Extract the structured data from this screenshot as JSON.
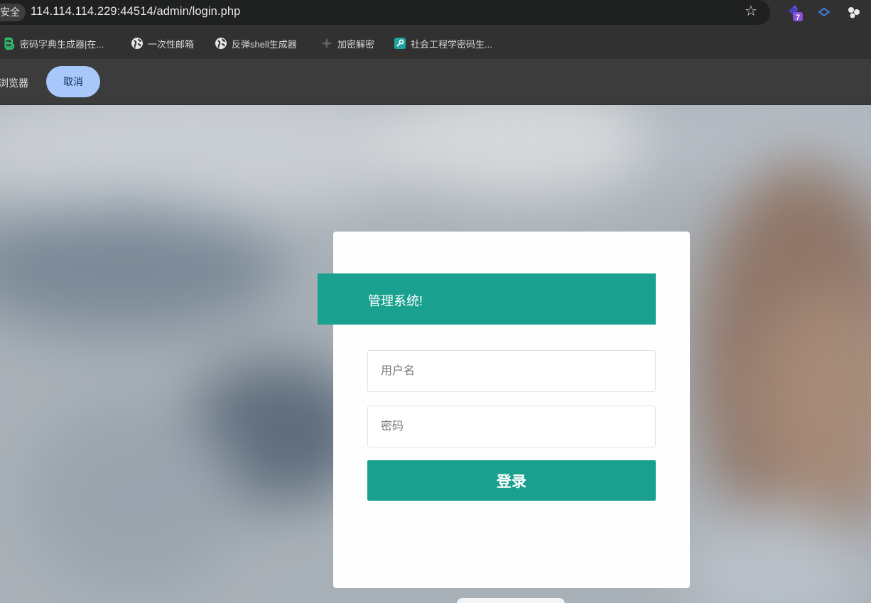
{
  "browser": {
    "security_label": "安全",
    "url": "114.114.114.229:44514/admin/login.php",
    "extension_badge": "7"
  },
  "bookmarks": [
    {
      "label": "密码字典生成器|在...",
      "icon": "b-logo-icon"
    },
    {
      "label": "一次性邮箱",
      "icon": "globe-icon"
    },
    {
      "label": "反弹shell生成器",
      "icon": "globe-icon"
    },
    {
      "label": "加密解密",
      "icon": "star-logo-icon"
    },
    {
      "label": "社会工程学密码生...",
      "icon": "key-square-icon"
    }
  ],
  "infobar": {
    "text": "浏览器",
    "cancel_label": "取消"
  },
  "login": {
    "title": "管理系统!",
    "username_placeholder": "用户名",
    "password_placeholder": "密码",
    "submit_label": "登录"
  },
  "colors": {
    "accent": "#1aa08f",
    "cancel_bg": "#a8c7fa",
    "chrome_dark": "#303130"
  }
}
